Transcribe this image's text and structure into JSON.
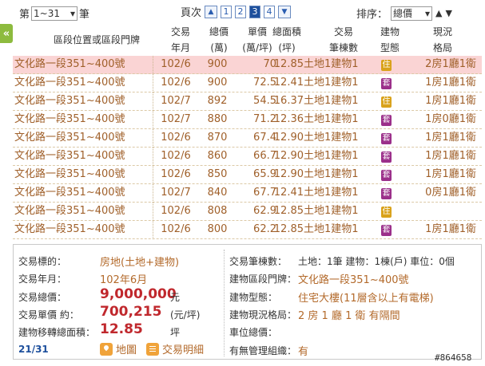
{
  "topbar": {
    "range_prefix": "第",
    "range_value": "1~31",
    "range_suffix": "筆",
    "pager_label": "頁次",
    "pages": [
      "1",
      "2",
      "3",
      "4"
    ],
    "active_page": "3",
    "sort_label": "排序：",
    "sort_value": "總價"
  },
  "header": {
    "addr": "區段位置或區段門牌",
    "date_1": "交易",
    "date_2": "年月",
    "total_1": "總價",
    "total_2": "(萬)",
    "unit_1": "單價",
    "unit_2": "(萬/坪)",
    "area_1": "總面積",
    "area_2": "(坪)",
    "parcel_1": "交易",
    "parcel_2": "筆棟數",
    "type_1": "建物",
    "type_2": "型態",
    "layout_1": "現況",
    "layout_2": "格局"
  },
  "rows": [
    {
      "addr": "文化路一段351~400號",
      "date": "102/6",
      "total": "900",
      "unit": "70",
      "area": "12.85",
      "parcel": "土地1建物1",
      "type": "住",
      "layout": "2房1廳1衛"
    },
    {
      "addr": "文化路一段351~400號",
      "date": "102/6",
      "total": "900",
      "unit": "72.5",
      "area": "12.41",
      "parcel": "土地1建物1",
      "type": "套",
      "layout": "1房1廳1衛"
    },
    {
      "addr": "文化路一段351~400號",
      "date": "102/7",
      "total": "892",
      "unit": "54.5",
      "area": "16.37",
      "parcel": "土地1建物1",
      "type": "住",
      "layout": "1房1廳1衛"
    },
    {
      "addr": "文化路一段351~400號",
      "date": "102/7",
      "total": "880",
      "unit": "71.2",
      "area": "12.36",
      "parcel": "土地1建物1",
      "type": "套",
      "layout": "1房0廳1衛"
    },
    {
      "addr": "文化路一段351~400號",
      "date": "102/6",
      "total": "870",
      "unit": "67.4",
      "area": "12.90",
      "parcel": "土地1建物1",
      "type": "套",
      "layout": "1房1廳1衛"
    },
    {
      "addr": "文化路一段351~400號",
      "date": "102/6",
      "total": "860",
      "unit": "66.7",
      "area": "12.90",
      "parcel": "土地1建物1",
      "type": "套",
      "layout": "1房1廳1衛"
    },
    {
      "addr": "文化路一段351~400號",
      "date": "102/6",
      "total": "850",
      "unit": "65.9",
      "area": "12.90",
      "parcel": "土地1建物1",
      "type": "套",
      "layout": "1房1廳1衛"
    },
    {
      "addr": "文化路一段351~400號",
      "date": "102/7",
      "total": "840",
      "unit": "67.7",
      "area": "12.41",
      "parcel": "土地1建物1",
      "type": "套",
      "layout": "0房1廳1衛"
    },
    {
      "addr": "文化路一段351~400號",
      "date": "102/6",
      "total": "808",
      "unit": "62.9",
      "area": "12.85",
      "parcel": "土地1建物1",
      "type": "住",
      "layout": ""
    },
    {
      "addr": "文化路一段351~400號",
      "date": "102/6",
      "total": "800",
      "unit": "62.2",
      "area": "12.85",
      "parcel": "土地1建物1",
      "type": "套",
      "layout": "1房1廳1衛"
    }
  ],
  "detail": {
    "target_label": "交易標的：",
    "target_value": "房地(土地+建物)",
    "date_label": "交易年月：",
    "date_value": "102年6月",
    "total_label": "交易總價：",
    "total_value": "9,000,000",
    "total_unit": "元",
    "unit_label": "交易單價 約：",
    "unit_value": "700,215",
    "unit_unit": "(元/坪)",
    "area_label": "建物移轉總面積：",
    "area_value": "12.85",
    "area_unit": "坪",
    "count_label": "交易筆棟數：",
    "count_value": "土地：1筆 建物：1棟(戶) 車位：0個",
    "addr_label": "建物區段門牌：",
    "addr_value": "文化路一段351~400號",
    "btype_label": "建物型態：",
    "btype_value": "住宅大樓(11層含以上有電梯)",
    "layout_label": "建物現況格局：",
    "layout_value": "2 房 1 廳 1 衛 有隔間",
    "parking_label": "車位總價：",
    "parking_value": "",
    "mgmt_label": "有無管理組織：",
    "mgmt_value": "有",
    "page_frac": "21/31",
    "map_label": "地圖",
    "detail_label": "交易明細"
  },
  "case_id": "#864658",
  "colors": {
    "accent": "#b36a2b",
    "highlight": "#fad4d4",
    "price": "#c0282d",
    "zhu": "#d9a21b",
    "tao": "#9b2f8a"
  }
}
